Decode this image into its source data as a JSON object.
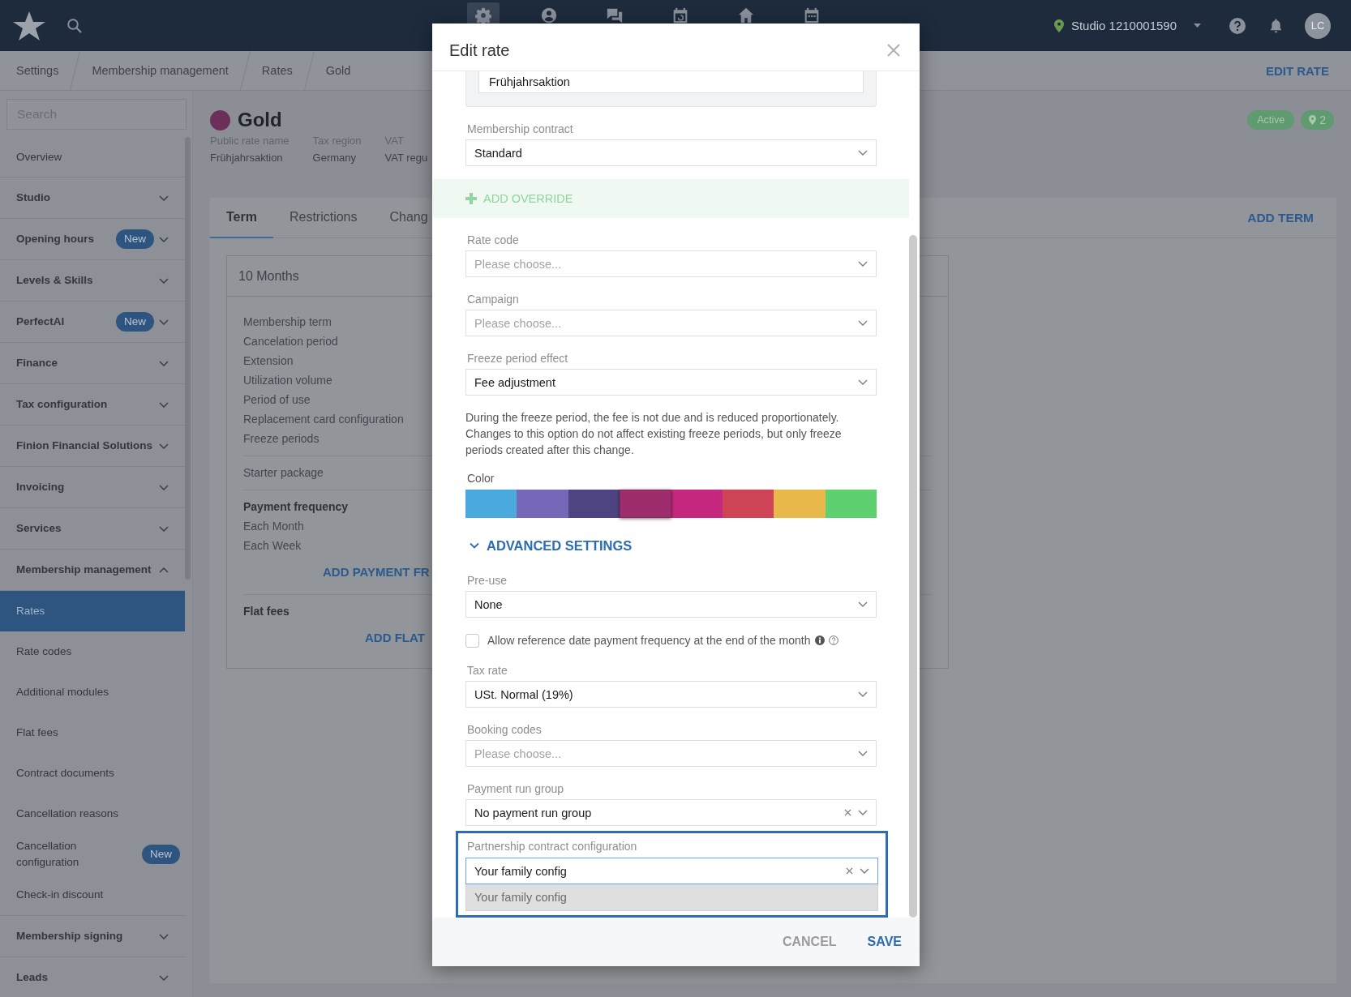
{
  "top_bar": {
    "nav_items": [
      {
        "kind": "gear",
        "selected": true
      },
      {
        "kind": "person",
        "selected": false
      },
      {
        "kind": "chat",
        "selected": false
      },
      {
        "kind": "calendar_sync",
        "selected": false
      },
      {
        "kind": "home",
        "selected": false
      },
      {
        "kind": "calendar",
        "selected": false
      }
    ],
    "studio": "Studio 1210001590",
    "avatar": "LC"
  },
  "breadcrumb": [
    "Settings",
    "Membership management",
    "Rates",
    "Gold"
  ],
  "page_action": "EDIT RATE",
  "sidebar": {
    "search": {
      "placeholder": "Search"
    },
    "items": [
      {
        "kind": "link",
        "label": "Overview",
        "selected": false
      },
      {
        "kind": "group",
        "label": "Studio",
        "expanded": false
      },
      {
        "kind": "group",
        "label": "Opening hours",
        "badge": "New",
        "expanded": false
      },
      {
        "kind": "group",
        "label": "Levels & Skills",
        "expanded": false
      },
      {
        "kind": "group",
        "label": "PerfectAI",
        "badge": "New",
        "expanded": false
      },
      {
        "kind": "group",
        "label": "Finance",
        "expanded": false
      },
      {
        "kind": "group",
        "label": "Tax configuration",
        "expanded": false
      },
      {
        "kind": "group",
        "label": "Finion Financial Solutions",
        "expanded": false
      },
      {
        "kind": "group",
        "label": "Invoicing",
        "expanded": false
      },
      {
        "kind": "group",
        "label": "Services",
        "expanded": false
      },
      {
        "kind": "group",
        "label": "Membership management",
        "expanded": true,
        "children": [
          {
            "label": "Rates",
            "selected": true
          },
          {
            "label": "Rate codes",
            "selected": false
          },
          {
            "label": "Additional modules",
            "selected": false
          },
          {
            "label": "Flat fees",
            "selected": false
          },
          {
            "label": "Contract documents",
            "selected": false
          },
          {
            "label": "Cancellation reasons",
            "selected": false
          },
          {
            "label": "Cancellation configuration",
            "badge": "New",
            "selected": false
          },
          {
            "label": "Check-in discount",
            "selected": false
          }
        ]
      },
      {
        "kind": "group",
        "label": "Membership signing",
        "expanded": false
      },
      {
        "kind": "group",
        "label": "Leads",
        "expanded": false
      }
    ]
  },
  "rate": {
    "name": "Gold",
    "status": "Active",
    "location_count": "2",
    "details": [
      {
        "label": "Public rate name",
        "value": "Frühjahrsaktion"
      },
      {
        "label": "Tax region",
        "value": "Germany"
      },
      {
        "label": "VAT",
        "value": "VAT regu"
      }
    ]
  },
  "tabs": [
    {
      "label": "Term",
      "selected": true
    },
    {
      "label": "Restrictions",
      "selected": false
    },
    {
      "label": "Chang",
      "selected": false
    }
  ],
  "tab_action": "ADD TERM",
  "term_card": {
    "title": "10 Months",
    "sections": [
      {
        "kind": "list",
        "items": [
          "Membership term",
          "Cancelation period",
          "Extension",
          "Utilization volume",
          "Period of use",
          "Replacement card configuration",
          "Freeze periods"
        ]
      },
      {
        "kind": "list",
        "items": [
          "Starter package"
        ]
      },
      {
        "kind": "group",
        "heading": "Payment frequency",
        "items": [
          "Each Month",
          "Each Week"
        ],
        "action": "ADD PAYMENT FR"
      },
      {
        "kind": "group",
        "heading": "Flat fees",
        "action": "ADD FLAT"
      }
    ]
  },
  "dialog": {
    "title": "Edit rate",
    "fields": [
      {
        "kind": "input_group",
        "value": "Frühjahrsaktion"
      },
      {
        "kind": "select",
        "label": "Membership contract",
        "value": "Standard",
        "clearable": false,
        "open": false,
        "highlighted": false
      },
      {
        "kind": "override",
        "label": "ADD OVERRIDE"
      },
      {
        "kind": "select",
        "label": "Rate code",
        "placeholder": "Please choose...",
        "clearable": false,
        "open": false,
        "highlighted": false
      },
      {
        "kind": "select",
        "label": "Campaign",
        "placeholder": "Please choose...",
        "clearable": false,
        "open": false,
        "highlighted": false
      },
      {
        "kind": "select",
        "label": "Freeze period effect",
        "value": "Fee adjustment",
        "clearable": false,
        "open": false,
        "highlighted": false
      },
      {
        "kind": "note",
        "text": "During the freeze period, the fee is not due and is reduced proportionately. Changes to this option do not affect existing freeze periods, but only freeze periods created after this change."
      },
      {
        "kind": "colors",
        "label": "Color",
        "swatches": [
          {
            "color": "#4aa9dd",
            "selected": false
          },
          {
            "color": "#7667b9",
            "selected": false
          },
          {
            "color": "#4e4481",
            "selected": false
          },
          {
            "color": "#9e2d6e",
            "selected": true
          },
          {
            "color": "#c7287f",
            "selected": false
          },
          {
            "color": "#cf4356",
            "selected": false
          },
          {
            "color": "#e8b84b",
            "selected": false
          },
          {
            "color": "#5ed06f",
            "selected": false
          }
        ]
      },
      {
        "kind": "section",
        "label": "ADVANCED SETTINGS",
        "expanded": true
      },
      {
        "kind": "select",
        "label": "Pre-use",
        "value": "None",
        "clearable": false,
        "open": false,
        "highlighted": false
      },
      {
        "kind": "checkbox",
        "label": "Allow reference date payment frequency at the end of the month",
        "checked": false
      },
      {
        "kind": "select",
        "label": "Tax rate",
        "value": "USt. Normal (19%)",
        "clearable": false,
        "open": false,
        "highlighted": false
      },
      {
        "kind": "select",
        "label": "Booking codes",
        "placeholder": "Please choose...",
        "clearable": false,
        "open": false,
        "highlighted": false
      },
      {
        "kind": "select",
        "label": "Payment run group",
        "value": "No payment run group",
        "clearable": true,
        "open": false,
        "highlighted": false
      },
      {
        "kind": "select",
        "label": "Partnership contract configuration",
        "value": "Your family config",
        "clearable": true,
        "open": true,
        "highlighted": true,
        "options": [
          {
            "label": "Your family config",
            "selected": true
          }
        ]
      }
    ],
    "buttons": [
      {
        "label": "CANCEL",
        "kind": "secondary"
      },
      {
        "label": "SAVE",
        "kind": "primary"
      }
    ]
  }
}
